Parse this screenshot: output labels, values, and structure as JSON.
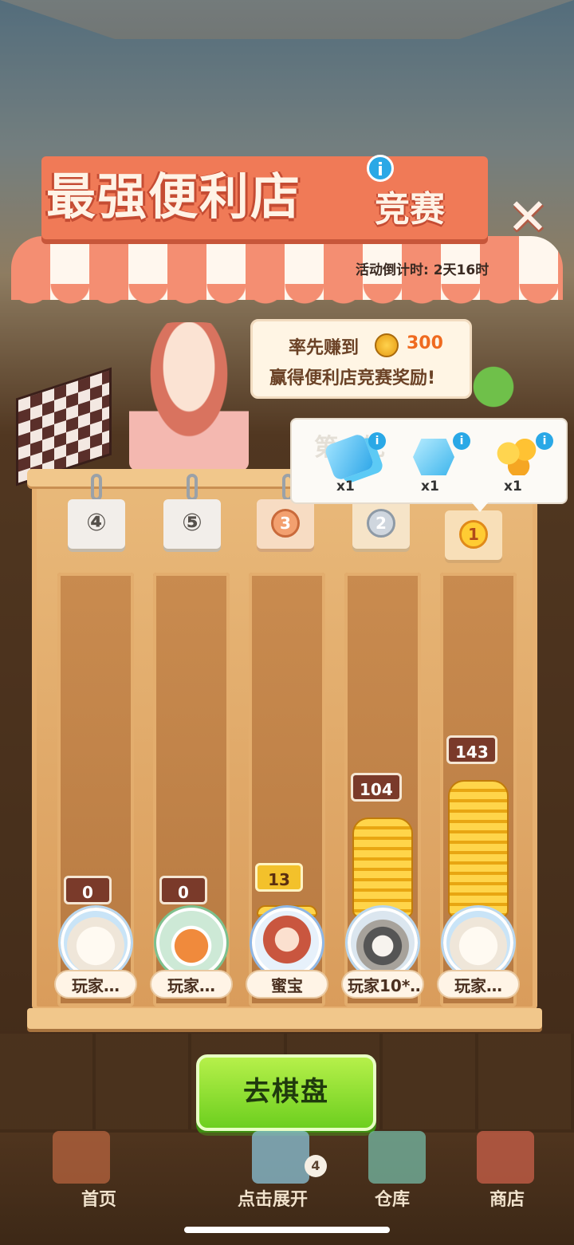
{
  "event": {
    "title_main": "最强便利店",
    "title_sub": "竞赛",
    "countdown": "活动倒计时: 2天16时",
    "info_label": "i",
    "close_label": "✕"
  },
  "bubble": {
    "line1_prefix": "率先赚到",
    "target": "300",
    "line2": "赢得便利店竞赛奖励!"
  },
  "rewards": {
    "round_label": "第__轮",
    "items": [
      {
        "icon": "diamonds-icon",
        "qty": "x1",
        "info": "i"
      },
      {
        "icon": "gem-icon",
        "qty": "x1",
        "info": "i"
      },
      {
        "icon": "paw-coins-icon",
        "qty": "x1",
        "info": "i"
      }
    ]
  },
  "ranks": [
    {
      "label": "④",
      "style": "plain"
    },
    {
      "label": "⑤",
      "style": "plain"
    },
    {
      "label": "3",
      "style": "bronze"
    },
    {
      "label": "2",
      "style": "silver"
    },
    {
      "label": "1",
      "style": "gold"
    }
  ],
  "players": [
    {
      "name": "玩家…",
      "score": "0",
      "avatar": "alpaca-avatar",
      "progress": 0
    },
    {
      "name": "玩家…",
      "score": "0",
      "avatar": "fox-avatar",
      "progress": 0
    },
    {
      "name": "蜜宝",
      "score": "13",
      "avatar": "girl-avatar",
      "progress": 0.043,
      "is_self": true
    },
    {
      "name": "玩家10*…",
      "score": "104",
      "avatar": "raccoon-avatar",
      "progress": 0.347
    },
    {
      "name": "玩家…",
      "score": "143",
      "avatar": "alpaca-avatar",
      "progress": 0.477
    }
  ],
  "actions": {
    "goto_board": "去棋盘"
  },
  "nav": {
    "home": "首页",
    "expand": "点击展开",
    "expand_badge": "4",
    "warehouse": "仓库",
    "shop": "商店"
  },
  "colors": {
    "accent": "#f07a57",
    "gold": "#ffd54a",
    "button_green": "#6dcf1f"
  }
}
